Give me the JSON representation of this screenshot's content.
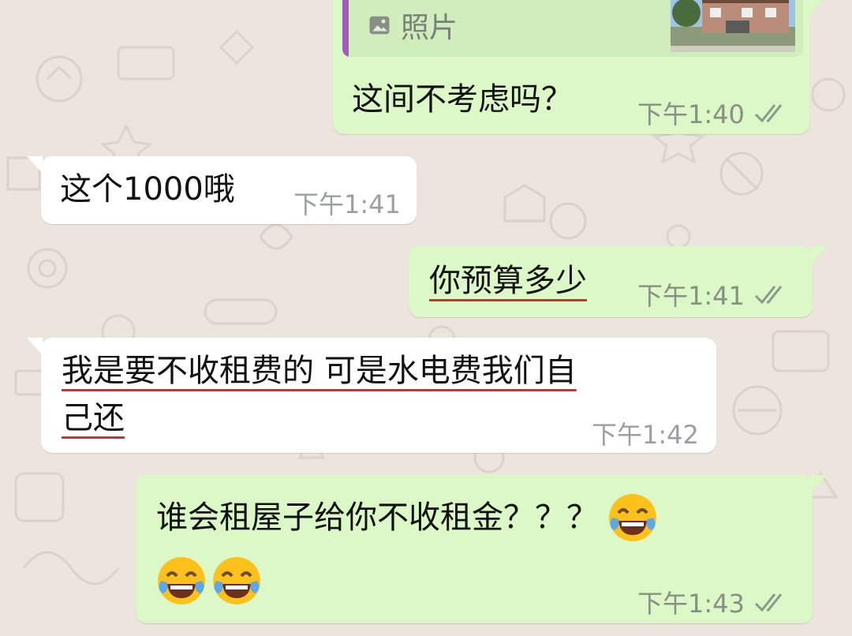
{
  "wallpaper_color": "#ece5dd",
  "colors": {
    "outgoing": "#dcf8c6",
    "incoming": "#ffffff",
    "read_ticks": "#8a9a8a",
    "underline": "#d32f2f",
    "quote_bar": "#a05cbe"
  },
  "messages": [
    {
      "direction": "out",
      "quote": {
        "number_text": "· · · · · · ·",
        "type_label": "照片",
        "icon": "photo-icon"
      },
      "text": "这间不考虑吗？",
      "time": "下午1:40",
      "status": "read"
    },
    {
      "direction": "in",
      "text": "这个1000哦",
      "time": "下午1:41"
    },
    {
      "direction": "out",
      "text": "你预算多少",
      "time": "下午1:41",
      "status": "read"
    },
    {
      "direction": "in",
      "line1": "我是要不收租费的 可是水电费我们自",
      "line2": "己还",
      "time": "下午1:42"
    },
    {
      "direction": "out",
      "line1": "谁会租屋子给你不收租金？？？",
      "emoji": [
        "face-with-tears-of-joy",
        "face-with-tears-of-joy",
        "face-with-tears-of-joy"
      ],
      "time": "下午1:43",
      "status": "read"
    }
  ]
}
